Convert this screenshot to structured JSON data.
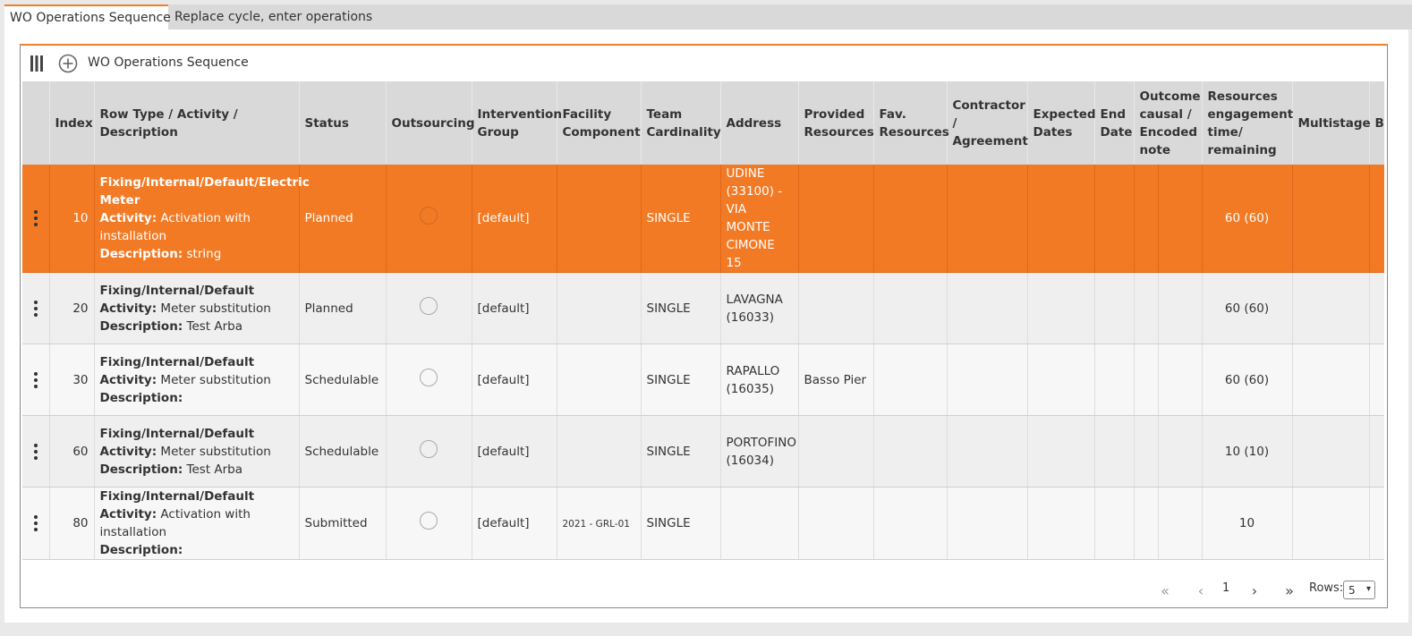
{
  "tabs": [
    {
      "label": "WO Operations Sequence",
      "active": true
    },
    {
      "label": "Replace cycle, enter operations",
      "active": false
    }
  ],
  "toolbar": {
    "title": "WO Operations Sequence",
    "columns_icon": "columns-icon",
    "add_icon": "plus-circle-icon"
  },
  "accent_color": "#f37a24",
  "table": {
    "columns": [
      "",
      "Index",
      "Row Type / Activity / Description",
      "Status",
      "Outsourcing",
      "Intervention Group",
      "Facility Component",
      "Team Cardinality",
      "Address",
      "Provided Resources",
      "Fav. Resources",
      "Contractor / Agreement",
      "Expected Dates",
      "End Date",
      "Outcome causal / Encoded note",
      "",
      "Resources engagement time/ remaining",
      "Multistage",
      "Bu Id"
    ],
    "activity_label": "Activity:",
    "description_label": "Description:",
    "rows": [
      {
        "index": "10",
        "row_type": "Fixing/Internal/Default/Electric Meter",
        "activity": "Activation with installation",
        "description": "string",
        "status": "Planned",
        "intervention_group": "[default]",
        "facility_component": "",
        "team_cardinality": "SINGLE",
        "address": "UDINE (33100) - VIA MONTE CIMONE 15",
        "provided_resources": "",
        "engagement": "60 (60)",
        "selected": true
      },
      {
        "index": "20",
        "row_type": "Fixing/Internal/Default",
        "activity": "Meter substitution",
        "description": "Test Arba",
        "status": "Planned",
        "intervention_group": "[default]",
        "facility_component": "",
        "team_cardinality": "SINGLE",
        "address": "LAVAGNA (16033)",
        "provided_resources": "",
        "engagement": "60 (60)",
        "selected": false
      },
      {
        "index": "30",
        "row_type": "Fixing/Internal/Default",
        "activity": "Meter substitution",
        "description": "",
        "status": "Schedulable",
        "intervention_group": "[default]",
        "facility_component": "",
        "team_cardinality": "SINGLE",
        "address": "RAPALLO (16035)",
        "provided_resources": "Basso Pier",
        "engagement": "60 (60)",
        "selected": false
      },
      {
        "index": "60",
        "row_type": "Fixing/Internal/Default",
        "activity": "Meter substitution",
        "description": "Test Arba",
        "status": "Schedulable",
        "intervention_group": "[default]",
        "facility_component": "",
        "team_cardinality": "SINGLE",
        "address": "PORTOFINO (16034)",
        "provided_resources": "",
        "engagement": "10 (10)",
        "selected": false
      },
      {
        "index": "80",
        "row_type": "Fixing/Internal/Default",
        "activity": "Activation with installation",
        "description": "",
        "status": "Submitted",
        "intervention_group": "[default]",
        "facility_component": "2021 - GRL-01",
        "team_cardinality": "SINGLE",
        "address": "",
        "provided_resources": "",
        "engagement": "10",
        "selected": false
      }
    ]
  },
  "paginator": {
    "first": "«",
    "prev": "‹",
    "page": "1",
    "next": "›",
    "last": "»",
    "rows_label": "Rows:",
    "rows_value": "5"
  }
}
